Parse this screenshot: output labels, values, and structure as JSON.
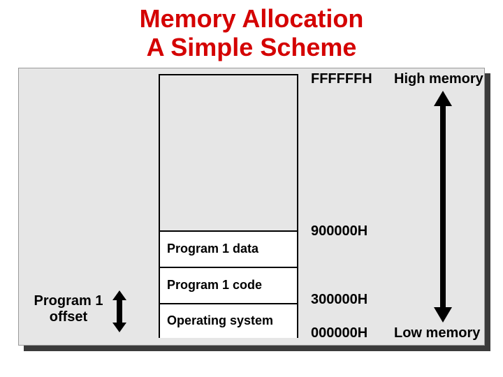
{
  "title": {
    "line1": "Memory Allocation",
    "line2": "A Simple Scheme"
  },
  "segments": {
    "data": "Program 1 data",
    "code": "Program 1 code",
    "os": "Operating system"
  },
  "addresses": {
    "top": "FFFFFFH",
    "a9": "900000H",
    "a3": "300000H",
    "a0": "000000H"
  },
  "labels": {
    "high": "High memory",
    "low": "Low memory",
    "offset_line1": "Program 1",
    "offset_line2": "offset"
  }
}
